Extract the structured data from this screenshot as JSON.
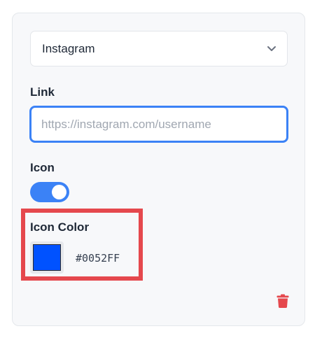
{
  "platform_select": {
    "value": "Instagram",
    "icon": "chevron-down-icon"
  },
  "link": {
    "label": "Link",
    "placeholder": "https://instagram.com/username",
    "value": ""
  },
  "icon_toggle": {
    "label": "Icon",
    "enabled": true,
    "color": "#3b82f6"
  },
  "icon_color": {
    "label": "Icon Color",
    "value": "#0052FF",
    "swatch_color": "#0052FF"
  },
  "delete": {
    "icon": "trash-icon",
    "color": "#e5484d"
  },
  "colors": {
    "accent": "#3b82f6",
    "highlight": "#e5484d"
  }
}
